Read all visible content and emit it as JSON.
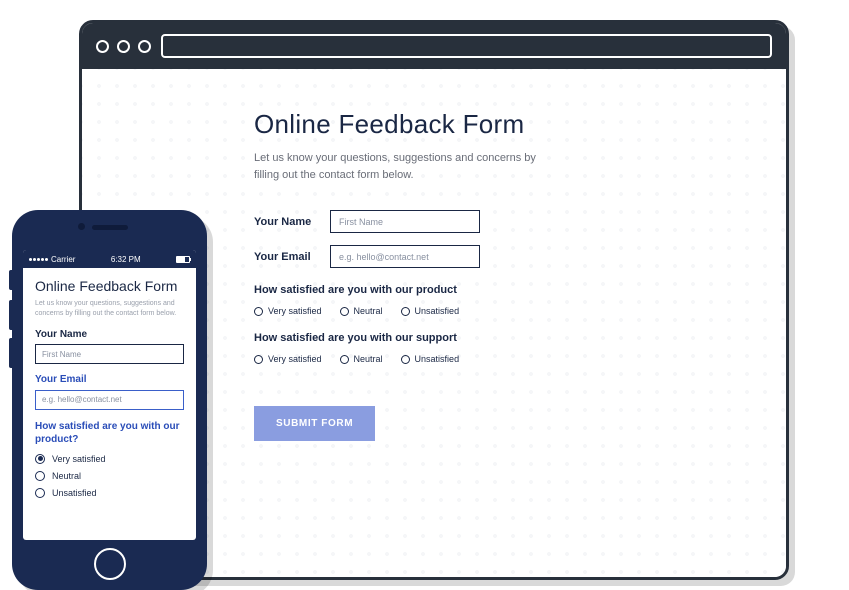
{
  "desktop": {
    "title": "Online Feedback Form",
    "subtitle": "Let us know your questions, suggestions and concerns by filling out the contact form below.",
    "name_label": "Your Name",
    "name_placeholder": "First Name",
    "email_label": "Your Email",
    "email_placeholder": "e.g. hello@contact.net",
    "q1": "How satisfied are you with our product",
    "q2": "How satisfied are you with our support",
    "opt1": "Very satisfied",
    "opt2": "Neutral",
    "opt3": "Unsatisfied",
    "submit": "SUBMIT FORM"
  },
  "mobile": {
    "status": {
      "carrier": "Carrier",
      "time": "6:32 PM"
    },
    "title": "Online Feedback Form",
    "subtitle": "Let us know your questions, suggestions and concerns by filling out the contact form below.",
    "name_label": "Your Name",
    "name_placeholder": "First Name",
    "email_label": "Your Email",
    "email_placeholder": "e.g. hello@contact.net",
    "q1": "How satisfied are you with our product?",
    "opt1": "Very satisfied",
    "opt2": "Neutral",
    "opt3": "Unsatisfied"
  }
}
